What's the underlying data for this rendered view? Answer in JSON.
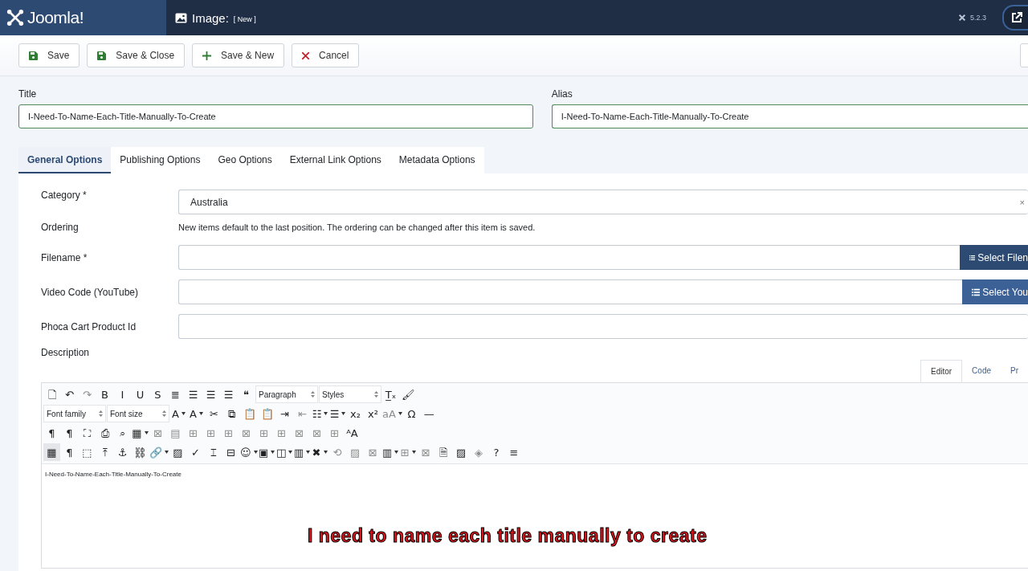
{
  "header": {
    "logo_text": "Joomla!",
    "title": "Image:",
    "title_tag": "[ New ]",
    "version": "5.2.3"
  },
  "toolbar": [
    {
      "kind": "save",
      "label": "Save"
    },
    {
      "kind": "save",
      "label": "Save & Close"
    },
    {
      "kind": "new",
      "label": "Save & New"
    },
    {
      "kind": "cancel",
      "label": "Cancel"
    }
  ],
  "title_field": {
    "label": "Title",
    "value": "I-Need-To-Name-Each-Title-Manually-To-Create"
  },
  "alias_field": {
    "label": "Alias",
    "value": "I-Need-To-Name-Each-Title-Manually-To-Create"
  },
  "tabs": [
    {
      "label": "General Options",
      "selected": true
    },
    {
      "label": "Publishing Options",
      "selected": false
    },
    {
      "label": "Geo Options",
      "selected": false
    },
    {
      "label": "External Link Options",
      "selected": false
    },
    {
      "label": "Metadata Options",
      "selected": false
    }
  ],
  "fields": [
    {
      "kind": "select",
      "label": "Category *",
      "value": "Australia",
      "clear": "×"
    },
    {
      "kind": "note",
      "label": "Ordering",
      "value": "New items default to the last position. The ordering can be changed after this item is saved."
    },
    {
      "kind": "picker",
      "label": "Filename *",
      "button": "Select Filen"
    },
    {
      "kind": "picker",
      "label": "Video Code (YouTube)",
      "button": "Select You"
    },
    {
      "kind": "text",
      "label": "Phoca Cart Product Id"
    }
  ],
  "description": {
    "label": "Description",
    "editor_tabs": [
      {
        "label": "Editor",
        "selected": true
      },
      {
        "label": "Code",
        "selected": false
      },
      {
        "label": "Pr",
        "selected": false
      }
    ],
    "toolbar_rows": [
      [
        {
          "kind": "button",
          "glyph": "🗋",
          "disabled": false
        },
        {
          "kind": "button",
          "glyph": "↶",
          "disabled": false
        },
        {
          "kind": "button",
          "glyph": "↷",
          "disabled": true
        },
        {
          "kind": "button",
          "glyph": "B",
          "disabled": false
        },
        {
          "kind": "button",
          "glyph": "I",
          "disabled": false
        },
        {
          "kind": "button",
          "glyph": "U",
          "disabled": false
        },
        {
          "kind": "button",
          "glyph": "S",
          "disabled": false
        },
        {
          "kind": "button",
          "glyph": "≣",
          "disabled": false
        },
        {
          "kind": "button",
          "glyph": "☰",
          "disabled": false
        },
        {
          "kind": "button",
          "glyph": "☰",
          "disabled": false
        },
        {
          "kind": "button",
          "glyph": "☰",
          "disabled": false
        },
        {
          "kind": "button",
          "glyph": "❝",
          "disabled": false
        },
        {
          "kind": "select",
          "label": "Paragraph"
        },
        {
          "kind": "select",
          "label": "Styles"
        },
        {
          "kind": "button",
          "glyph": "T̲ₓ",
          "disabled": false
        },
        {
          "kind": "button",
          "glyph": "🖌",
          "disabled": false
        }
      ],
      [
        {
          "kind": "select",
          "label": "Font family"
        },
        {
          "kind": "select",
          "label": "Font size"
        },
        {
          "kind": "split",
          "glyph": "A",
          "disabled": false
        },
        {
          "kind": "split",
          "glyph": "A",
          "disabled": false
        },
        {
          "kind": "button",
          "glyph": "✂",
          "disabled": false
        },
        {
          "kind": "button",
          "glyph": "⧉",
          "disabled": false
        },
        {
          "kind": "button",
          "glyph": "📋",
          "disabled": false
        },
        {
          "kind": "button",
          "glyph": "📋",
          "disabled": false
        },
        {
          "kind": "button",
          "glyph": "⇥",
          "disabled": false
        },
        {
          "kind": "button",
          "glyph": "⇤",
          "disabled": true
        },
        {
          "kind": "split",
          "glyph": "☷",
          "disabled": false
        },
        {
          "kind": "split",
          "glyph": "☰",
          "disabled": false
        },
        {
          "kind": "button",
          "glyph": "x₂",
          "disabled": false
        },
        {
          "kind": "button",
          "glyph": "x²",
          "disabled": false
        },
        {
          "kind": "split",
          "glyph": "aA",
          "disabled": true
        },
        {
          "kind": "button",
          "glyph": "Ω",
          "disabled": false
        },
        {
          "kind": "button",
          "glyph": "—",
          "disabled": false
        }
      ],
      [
        {
          "kind": "button",
          "glyph": "¶",
          "disabled": false
        },
        {
          "kind": "button",
          "glyph": "¶",
          "disabled": false
        },
        {
          "kind": "button",
          "glyph": "⛶",
          "disabled": false
        },
        {
          "kind": "button",
          "glyph": "⎙",
          "disabled": false
        },
        {
          "kind": "button",
          "glyph": "⌕",
          "disabled": false
        },
        {
          "kind": "split",
          "glyph": "▦",
          "disabled": false
        },
        {
          "kind": "button",
          "glyph": "⊠",
          "disabled": true
        },
        {
          "kind": "button",
          "glyph": "▤",
          "disabled": true
        },
        {
          "kind": "button",
          "glyph": "⊞",
          "disabled": true
        },
        {
          "kind": "button",
          "glyph": "⊞",
          "disabled": true
        },
        {
          "kind": "button",
          "glyph": "⊞",
          "disabled": true
        },
        {
          "kind": "button",
          "glyph": "⊠",
          "disabled": true
        },
        {
          "kind": "button",
          "glyph": "⊞",
          "disabled": true
        },
        {
          "kind": "button",
          "glyph": "⊞",
          "disabled": true
        },
        {
          "kind": "button",
          "glyph": "⊠",
          "disabled": true
        },
        {
          "kind": "button",
          "glyph": "⊠",
          "disabled": true
        },
        {
          "kind": "button",
          "glyph": "⊞",
          "disabled": true
        },
        {
          "kind": "button",
          "glyph": "ᴬA",
          "disabled": false
        }
      ],
      [
        {
          "kind": "button",
          "glyph": "▦",
          "disabled": false
        },
        {
          "kind": "button",
          "glyph": "¶",
          "disabled": false
        },
        {
          "kind": "button",
          "glyph": "⬚",
          "disabled": false
        },
        {
          "kind": "button",
          "glyph": "⤒",
          "disabled": false
        },
        {
          "kind": "button",
          "glyph": "⚓",
          "disabled": false
        },
        {
          "kind": "button",
          "glyph": "⛓",
          "disabled": false
        },
        {
          "kind": "split",
          "glyph": "🔗",
          "disabled": false
        },
        {
          "kind": "button",
          "glyph": "▨",
          "disabled": false
        },
        {
          "kind": "button",
          "glyph": "✓",
          "disabled": false
        },
        {
          "kind": "button",
          "glyph": "⌶",
          "disabled": false
        },
        {
          "kind": "button",
          "glyph": "⊟",
          "disabled": false
        },
        {
          "kind": "split",
          "glyph": "☺",
          "disabled": false
        },
        {
          "kind": "split",
          "glyph": "▣",
          "disabled": false
        },
        {
          "kind": "split",
          "glyph": "◫",
          "disabled": false
        },
        {
          "kind": "split",
          "glyph": "▥",
          "disabled": false
        },
        {
          "kind": "split",
          "glyph": "✖",
          "disabled": false
        },
        {
          "kind": "button",
          "glyph": "⟲",
          "disabled": true
        },
        {
          "kind": "button",
          "glyph": "▨",
          "disabled": true
        },
        {
          "kind": "button",
          "glyph": "⊠",
          "disabled": true
        },
        {
          "kind": "split",
          "glyph": "▥",
          "disabled": false
        },
        {
          "kind": "split",
          "glyph": "⊞",
          "disabled": true
        },
        {
          "kind": "button",
          "glyph": "⊠",
          "disabled": true
        },
        {
          "kind": "button",
          "glyph": "🗎",
          "disabled": false
        },
        {
          "kind": "button",
          "glyph": "▨",
          "disabled": false
        },
        {
          "kind": "button",
          "glyph": "◈",
          "disabled": true
        },
        {
          "kind": "button",
          "glyph": "?",
          "disabled": false
        },
        {
          "kind": "button",
          "glyph": "≡",
          "disabled": false
        }
      ]
    ],
    "content": "I-Need-To-Name-Each-Title-Manually-To-Create"
  },
  "annotation": "I need to name each title manually to create"
}
